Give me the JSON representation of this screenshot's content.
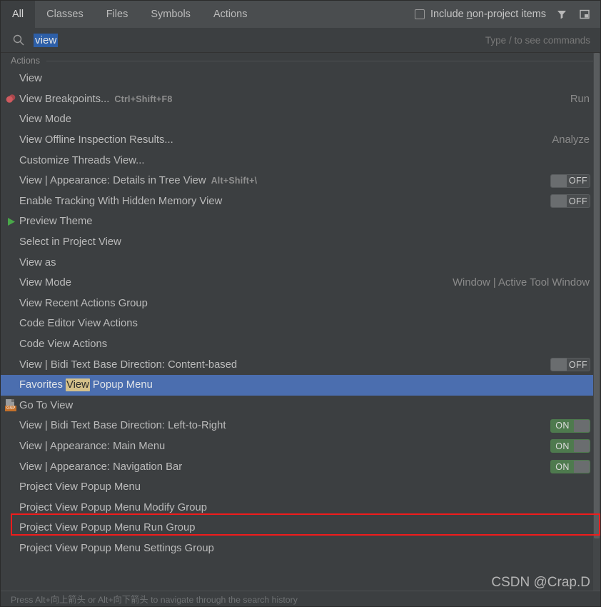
{
  "header": {
    "tabs": [
      {
        "label": "All",
        "active": true
      },
      {
        "label": "Classes",
        "active": false
      },
      {
        "label": "Files",
        "active": false
      },
      {
        "label": "Symbols",
        "active": false
      },
      {
        "label": "Actions",
        "active": false
      }
    ],
    "include_checkbox": {
      "label_before": "Include ",
      "label_underline": "n",
      "label_after": "on-project items",
      "checked": false
    },
    "filter_icon": "filter-funnel-icon",
    "preview_icon": "preview-window-icon"
  },
  "search": {
    "icon": "search-icon",
    "value": "view",
    "hint": "Type / to see commands"
  },
  "group": {
    "label": "Actions"
  },
  "results": [
    {
      "label": "View",
      "icon": null,
      "shortcut": null,
      "right": null,
      "toggle": null
    },
    {
      "label": "View Breakpoints...",
      "icon": "breakpoint-icon",
      "shortcut": "Ctrl+Shift+F8",
      "right": "Run",
      "toggle": null
    },
    {
      "label": "View Mode",
      "icon": null,
      "shortcut": null,
      "right": null,
      "toggle": null
    },
    {
      "label": "View Offline Inspection Results...",
      "icon": null,
      "shortcut": null,
      "right": "Analyze",
      "toggle": null
    },
    {
      "label": "Customize Threads View...",
      "icon": null,
      "shortcut": null,
      "right": null,
      "toggle": null
    },
    {
      "label": "View | Appearance: Details in Tree View",
      "icon": null,
      "shortcut": "Alt+Shift+\\",
      "right": null,
      "toggle": "OFF"
    },
    {
      "label": "Enable Tracking With Hidden Memory View",
      "icon": null,
      "shortcut": null,
      "right": null,
      "toggle": "OFF"
    },
    {
      "label": "Preview Theme",
      "icon": "play-icon",
      "shortcut": null,
      "right": null,
      "toggle": null
    },
    {
      "label": "Select in Project View",
      "icon": null,
      "shortcut": null,
      "right": null,
      "toggle": null
    },
    {
      "label": "View as",
      "icon": null,
      "shortcut": null,
      "right": null,
      "toggle": null
    },
    {
      "label": "View Mode",
      "icon": null,
      "shortcut": null,
      "right": "Window | Active Tool Window",
      "toggle": null
    },
    {
      "label": "View Recent Actions Group",
      "icon": null,
      "shortcut": null,
      "right": null,
      "toggle": null
    },
    {
      "label": "Code Editor View Actions",
      "icon": null,
      "shortcut": null,
      "right": null,
      "toggle": null
    },
    {
      "label": "Code View Actions",
      "icon": null,
      "shortcut": null,
      "right": null,
      "toggle": null
    },
    {
      "label": "View | Bidi Text Base Direction: Content-based",
      "icon": null,
      "shortcut": null,
      "right": null,
      "toggle": "OFF"
    },
    {
      "label": "Favorites View Popup Menu",
      "label_pre": "Favorites ",
      "label_hl": "View",
      "label_post": " Popup Menu",
      "icon": null,
      "shortcut": null,
      "right": null,
      "toggle": null,
      "selected": true
    },
    {
      "label": "Go To View",
      "icon": "gsp-file-icon",
      "shortcut": null,
      "right": null,
      "toggle": null
    },
    {
      "label": "View | Bidi Text Base Direction: Left-to-Right",
      "icon": null,
      "shortcut": null,
      "right": null,
      "toggle": "ON"
    },
    {
      "label": "View | Appearance: Main Menu",
      "icon": null,
      "shortcut": null,
      "right": null,
      "toggle": "ON",
      "annotated": true
    },
    {
      "label": "View | Appearance: Navigation Bar",
      "icon": null,
      "shortcut": null,
      "right": null,
      "toggle": "ON"
    },
    {
      "label": "Project View Popup Menu",
      "icon": null,
      "shortcut": null,
      "right": null,
      "toggle": null
    },
    {
      "label": "Project View Popup Menu Modify Group",
      "icon": null,
      "shortcut": null,
      "right": null,
      "toggle": null
    },
    {
      "label": "Project View Popup Menu Run Group",
      "icon": null,
      "shortcut": null,
      "right": null,
      "toggle": null
    },
    {
      "label": "Project View Popup Menu Settings Group",
      "icon": null,
      "shortcut": null,
      "right": null,
      "toggle": null
    }
  ],
  "statusbar": {
    "text": "Press Alt+向上箭头 or Alt+向下箭头 to navigate through the search history"
  },
  "watermark": {
    "text": "CSDN @Crap.D"
  },
  "colors": {
    "background": "#3c3f41",
    "tabbar": "#4a4d4f",
    "selection": "#4b6eaf",
    "search_selection": "#2d5fa8",
    "match_highlight": "#d4c08a",
    "toggle_on": "#4e7a4e",
    "annotation_red": "#f01c1c",
    "breakpoint_red": "#d05a5a",
    "play_green": "#49a849"
  }
}
